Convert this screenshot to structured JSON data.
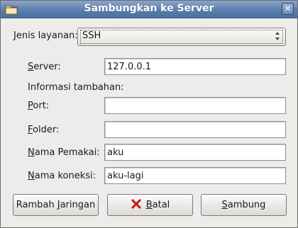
{
  "window": {
    "title": "Sambungkan ke Server"
  },
  "service": {
    "label_prefix": "J",
    "label_rest": "enis layanan:",
    "value": "SSH"
  },
  "form": {
    "server": {
      "label_prefix": "S",
      "label_rest": "erver:",
      "value": "127.0.0.1"
    },
    "info_heading": "Informasi tambahan:",
    "port": {
      "label_prefix": "P",
      "label_rest": "ort:",
      "value": ""
    },
    "folder": {
      "label_prefix": "F",
      "label_rest": "older:",
      "value": ""
    },
    "user": {
      "label_prefix": "N",
      "label_rest": "ama Pemakai:",
      "value": "aku"
    },
    "conn_name": {
      "label_prefix": "N",
      "label_rest": "ama koneksi:",
      "value": "aku-lagi"
    }
  },
  "buttons": {
    "browse": {
      "pre": "Rambah ",
      "mn": "J",
      "post": "aringan"
    },
    "cancel": {
      "mn": "B",
      "post": "atal"
    },
    "connect": {
      "mn": "S",
      "post": "ambung"
    }
  },
  "colors": {
    "titlebar": "#5b7eaf",
    "window_bg": "#edecea",
    "cancel_icon": "#c0261f"
  }
}
